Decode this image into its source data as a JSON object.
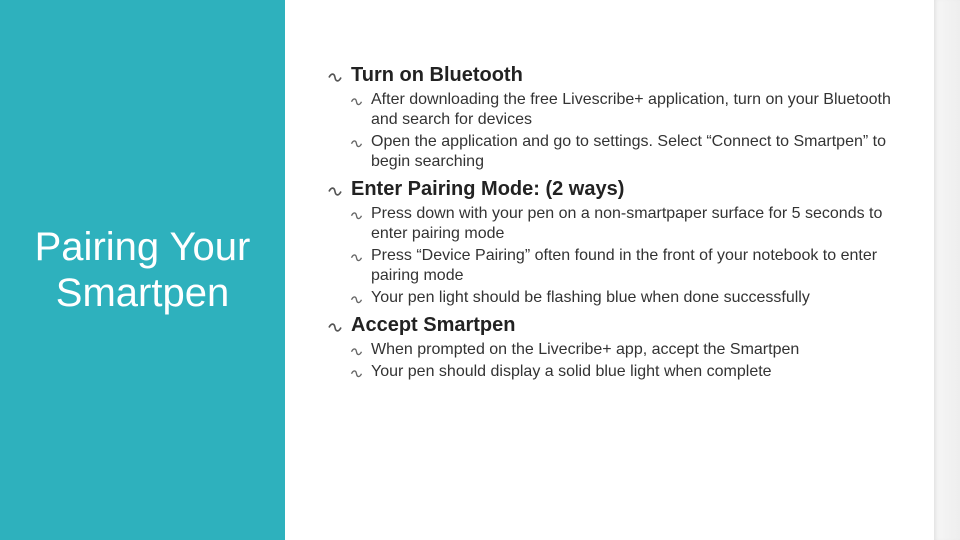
{
  "title": "Pairing Your Smartpen",
  "sections": [
    {
      "heading": "Turn on Bluetooth",
      "items": [
        "After downloading the free Livescribe+ application, turn on your Bluetooth and search for devices",
        "Open the application and go to settings. Select “Connect to Smartpen” to begin searching"
      ]
    },
    {
      "heading": "Enter Pairing Mode: (2 ways)",
      "items": [
        "Press down with your pen on a non-smartpaper surface for 5 seconds to enter pairing mode",
        "Press “Device Pairing” often found in the front of your notebook to enter pairing mode",
        "Your pen light should be flashing blue when done successfully"
      ]
    },
    {
      "heading": "Accept Smartpen",
      "items": [
        "When prompted on the Livecribe+ app, accept the Smartpen",
        "Your pen should display a solid blue light when complete"
      ]
    }
  ]
}
